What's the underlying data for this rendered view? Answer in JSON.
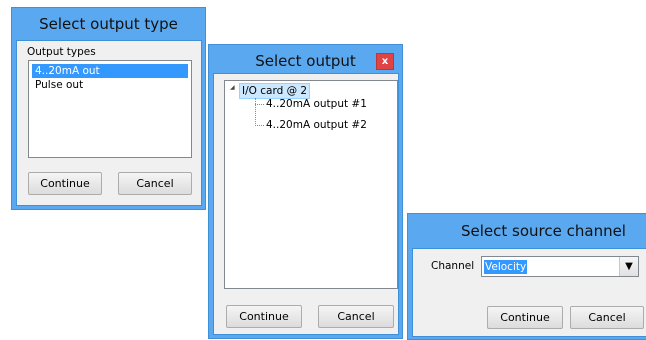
{
  "dialog_output_type": {
    "title": "Select output type",
    "group_label": "Output types",
    "items": [
      "4..20mA out",
      "Pulse out"
    ],
    "selected_index": 0,
    "continue_label": "Continue",
    "cancel_label": "Cancel"
  },
  "dialog_output": {
    "title": "Select output",
    "close_glyph": "x",
    "expand_glyph": "◢",
    "tree_root": "I/O card @ 2",
    "tree_children": [
      "4..20mA output #1",
      "4..20mA output #2"
    ],
    "continue_label": "Continue",
    "cancel_label": "Cancel"
  },
  "dialog_source": {
    "title": "Select source channel",
    "channel_label": "Channel",
    "channel_value": "Velocity",
    "dropdown_glyph": "▼",
    "continue_label": "Continue",
    "cancel_label": "Cancel"
  },
  "colors": {
    "frame": "#5aa9f0",
    "selection": "#3399ff",
    "close_button": "#e04343"
  }
}
